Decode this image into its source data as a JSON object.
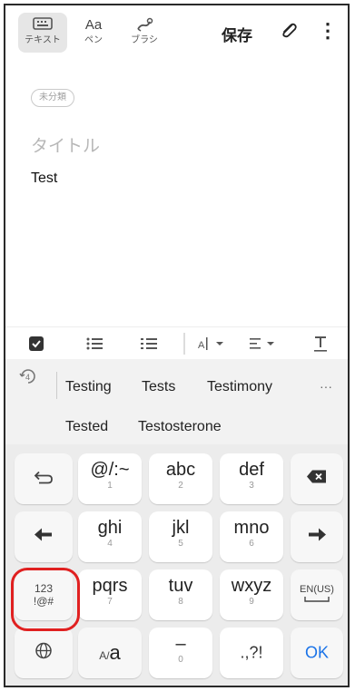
{
  "toolbar": {
    "modes": [
      {
        "label": "テキスト",
        "icon": "keyboard-icon",
        "active": true
      },
      {
        "label": "ペン",
        "icon": "pen-text-icon",
        "active": false
      },
      {
        "label": "ブラシ",
        "icon": "brush-icon",
        "active": false
      }
    ],
    "pen_icon_text": "Aa",
    "save_label": "保存",
    "more_label": "⋮"
  },
  "note": {
    "category_label": "未分類",
    "title_placeholder": "タイトル",
    "body_text": "Test"
  },
  "formatting": {
    "icons": [
      "checkbox-icon",
      "bullet-list-icon",
      "numbered-list-icon",
      "font-size-icon",
      "align-icon",
      "text-style-icon"
    ]
  },
  "suggestions": {
    "row1": [
      "Testing",
      "Tests",
      "Testimony"
    ],
    "row2": [
      "Tested",
      "Testosterone"
    ],
    "more_label": "···"
  },
  "keyboard": {
    "row1": {
      "key1": {
        "main": "@/:~",
        "sub": "1"
      },
      "key2": {
        "main": "abc",
        "sub": "2"
      },
      "key3": {
        "main": "def",
        "sub": "3"
      }
    },
    "row2": {
      "key1": {
        "main": "ghi",
        "sub": "4"
      },
      "key2": {
        "main": "jkl",
        "sub": "5"
      },
      "key3": {
        "main": "mno",
        "sub": "6"
      }
    },
    "row3": {
      "mode": "123\n!@#",
      "mode_line1": "123",
      "mode_line2": "!@#",
      "key1": {
        "main": "pqrs",
        "sub": "7"
      },
      "key2": {
        "main": "tuv",
        "sub": "8"
      },
      "key3": {
        "main": "wxyz",
        "sub": "9"
      },
      "lang": "EN(US)"
    },
    "row4": {
      "case_small": "A/",
      "case_big": "a",
      "dash_main": "–",
      "dash_sub": "0",
      "punct": ".,?!",
      "ok": "OK"
    }
  },
  "colors": {
    "accent": "#1a73e8",
    "highlight": "#e02020"
  }
}
